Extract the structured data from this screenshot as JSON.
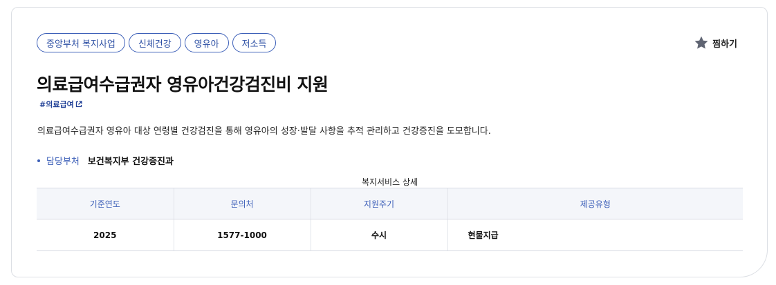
{
  "tags": [
    "중앙부처 복지사업",
    "신체건강",
    "영유아",
    "저소득"
  ],
  "bookmark": {
    "label": "찜하기",
    "icon": "star-icon"
  },
  "title": "의료급여수급권자 영유아건강검진비 지원",
  "keyword": {
    "label": "#의료급여",
    "icon": "external-link-icon"
  },
  "description": "의료급여수급권자 영유아 대상 연령별 건강검진을 통해 영유아의 성장·발달 사항을 추적 관리하고 건강증진을 도모합니다.",
  "department": {
    "label": "담당부처",
    "value": "보건복지부 건강증진과"
  },
  "table": {
    "caption": "복지서비스 상세",
    "headers": [
      "기준연도",
      "문의처",
      "지원주기",
      "제공유형"
    ],
    "row": [
      "2025",
      "1577-1000",
      "수시",
      "현물지급"
    ]
  },
  "colors": {
    "accent": "#3c5fb8",
    "header_bg": "#f4f6fa",
    "star": "#5f6472"
  }
}
